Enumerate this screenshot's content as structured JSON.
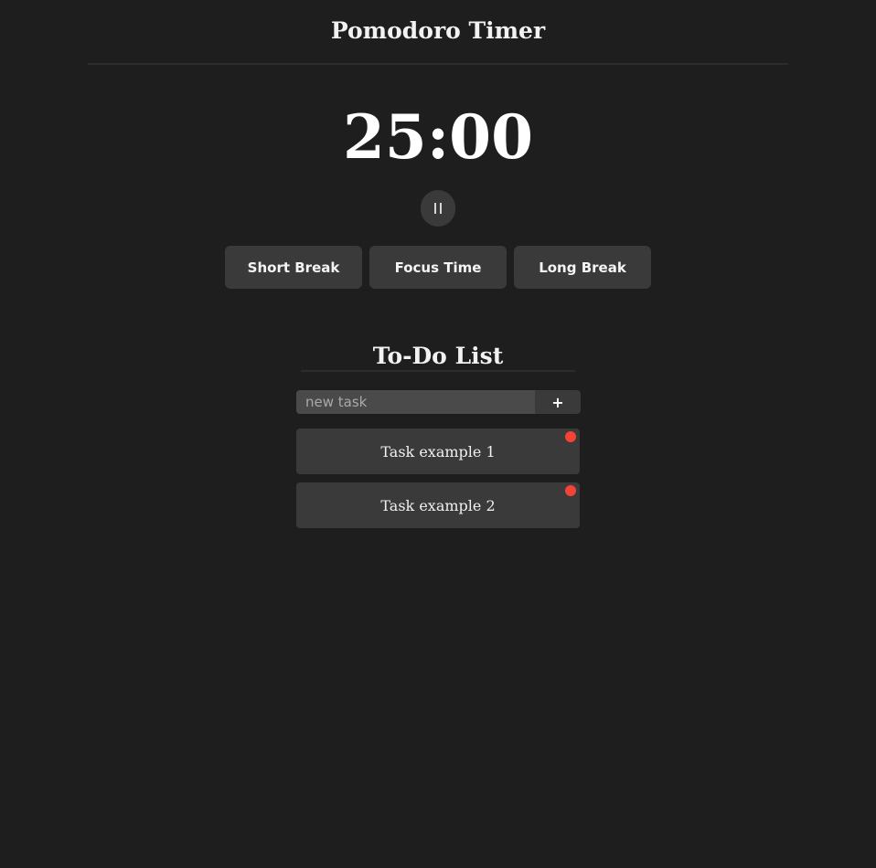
{
  "header": {
    "title": "Pomodoro Timer"
  },
  "timer": {
    "display": "25:00",
    "pause_symbol": "II"
  },
  "modes": [
    {
      "label": "Short Break"
    },
    {
      "label": "Focus Time"
    },
    {
      "label": "Long Break"
    }
  ],
  "todo": {
    "title": "To-Do List",
    "input_placeholder": "new task",
    "input_value": "",
    "add_label": "+",
    "tasks": [
      {
        "label": "Task example 1"
      },
      {
        "label": "Task example 2"
      }
    ]
  },
  "colors": {
    "background": "#1e1e1e",
    "button": "#3a3a3a",
    "input": "#4a4a4a",
    "delete_dot": "#f44336"
  },
  "icons": {
    "pause": "pause-icon",
    "delete": "delete-dot-icon"
  }
}
